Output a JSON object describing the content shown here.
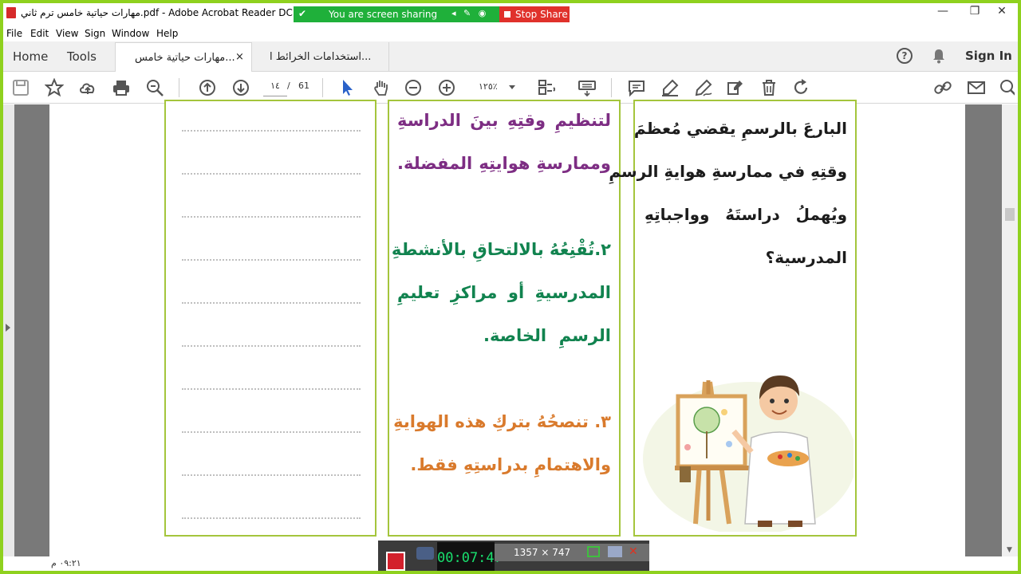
{
  "window": {
    "title": "مهارات حياتية خامس ترم ثاني.pdf - Adobe Acrobat Reader DC (64-bit)",
    "minimize": "—",
    "restore": "❐",
    "close": "✕"
  },
  "share_bar": {
    "label": "You are screen sharing",
    "stop_label": "Stop Share",
    "accent": "#1fb03a",
    "stop_color": "#e0312b"
  },
  "menu": [
    "File",
    "Edit",
    "View",
    "Sign",
    "Window",
    "Help"
  ],
  "nav_tabs": {
    "home": "Home",
    "tools": "Tools"
  },
  "doc_tabs": [
    {
      "label": "مهارات حياتية خامس...",
      "active": true,
      "close": "×"
    },
    {
      "label": "استخدامات الخرائط ا...",
      "active": false
    }
  ],
  "header_right": {
    "help": "?",
    "sign_in": "Sign In"
  },
  "toolbar": {
    "page_current": "١٤",
    "page_sep": "/",
    "page_total": "61",
    "zoom": "١٢٥٪"
  },
  "document": {
    "middle_lines": [
      {
        "text": "لتنظيمِ وقتِهِ بينَ الدراسةِ",
        "color": "purple"
      },
      {
        "text": "وممارسةِ هوايتِهِ المفضلة.",
        "color": "purple"
      },
      {
        "text": "٢.تُقْنِعُهُ بالالتحاقِ بالأنشطةِ",
        "color": "green"
      },
      {
        "text": "المدرسيةِ أو مراكزِ تعليمِ",
        "color": "green"
      },
      {
        "text": "الرسمِ الخاصة.",
        "color": "green"
      },
      {
        "text": "٣. تنصحُهُ بتركِ هذه الهوايةِ",
        "color": "orange"
      },
      {
        "text": "والاهتمامِ بدراستِهِ فقط.",
        "color": "orange"
      }
    ],
    "right_lines": [
      "البارعَ بالرسمِ يقضي مُعظمَ",
      "وقتِهِ في ممارسةِ هوايةِ الرسمِ",
      "ويُهملُ دراستَهُ وواجباتِهِ",
      "المدرسية؟"
    ],
    "dotted_line_count": 10
  },
  "recorder": {
    "timer": "00:07:47",
    "dimensions": "1357 × 747"
  },
  "taskbar": {
    "clock": "٠٩:٢١ م"
  }
}
